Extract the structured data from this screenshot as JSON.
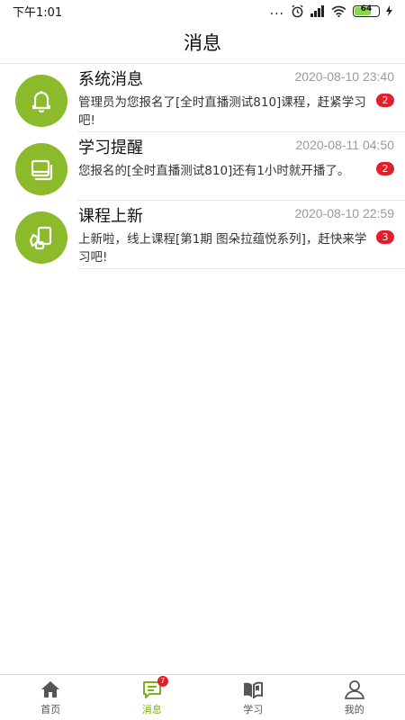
{
  "status_bar": {
    "time": "下午1:01",
    "battery": "64",
    "dots": "..."
  },
  "header": {
    "title": "消息"
  },
  "messages": [
    {
      "title": "系统消息",
      "time": "2020-08-10 23:40",
      "text": "管理员为您报名了[全时直播测试810]课程，赶紧学习吧!",
      "badge": "2",
      "icon": "bell-icon"
    },
    {
      "title": "学习提醒",
      "time": "2020-08-11 04:50",
      "text": "您报名的[全时直播测试810]还有1小时就开播了。",
      "badge": "2",
      "icon": "book-icon"
    },
    {
      "title": "课程上新",
      "time": "2020-08-10 22:59",
      "text": "上新啦，线上课程[第1期 图朵拉蕴悦系列]，赶快来学习吧!",
      "badge": "3",
      "icon": "new-course-icon"
    }
  ],
  "tabs": [
    {
      "label": "首页",
      "icon": "home-icon"
    },
    {
      "label": "消息",
      "icon": "message-icon",
      "badge": "7",
      "active": true
    },
    {
      "label": "学习",
      "icon": "study-book-icon"
    },
    {
      "label": "我的",
      "icon": "profile-icon"
    }
  ],
  "colors": {
    "accent": "#7fae1f",
    "icon_bg": "#8bbb2a",
    "badge": "#e0202a"
  }
}
